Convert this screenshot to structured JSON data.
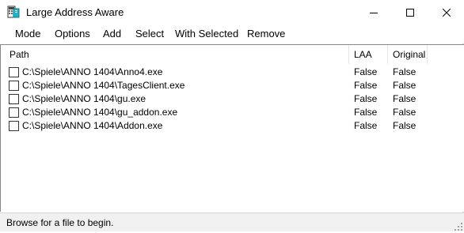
{
  "window": {
    "title": "Large Address Aware"
  },
  "menu": {
    "mode": "Mode",
    "options": "Options",
    "add": "Add",
    "select": "Select",
    "with_selected": "With Selected",
    "remove": "Remove"
  },
  "list": {
    "columns": {
      "path": "Path",
      "laa": "LAA",
      "original": "Original"
    },
    "rows": [
      {
        "path": "C:\\Spiele\\ANNO 1404\\Anno4.exe",
        "laa": "False",
        "original": "False",
        "checked": false
      },
      {
        "path": "C:\\Spiele\\ANNO 1404\\TagesClient.exe",
        "laa": "False",
        "original": "False",
        "checked": false
      },
      {
        "path": "C:\\Spiele\\ANNO 1404\\gu.exe",
        "laa": "False",
        "original": "False",
        "checked": false
      },
      {
        "path": "C:\\Spiele\\ANNO 1404\\gu_addon.exe",
        "laa": "False",
        "original": "False",
        "checked": false
      },
      {
        "path": "C:\\Spiele\\ANNO 1404\\Addon.exe",
        "laa": "False",
        "original": "False",
        "checked": false
      }
    ]
  },
  "status": {
    "text": "Browse for a file to begin."
  },
  "icons": {
    "app": "app-icon",
    "minimize": "minimize-icon",
    "maximize": "maximize-icon",
    "close": "close-icon",
    "checkbox": "checkbox-icon",
    "resize_grip": "resize-grip-icon"
  }
}
